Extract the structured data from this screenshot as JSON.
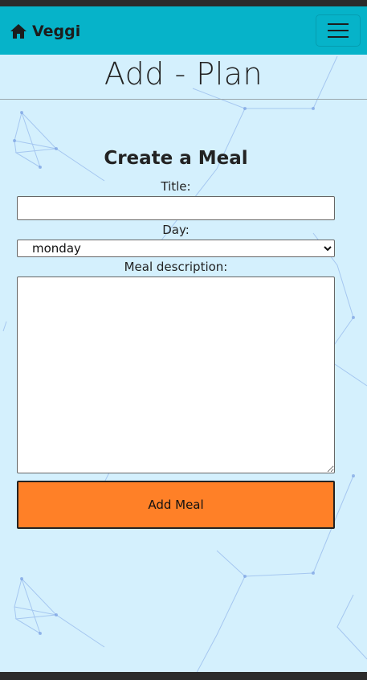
{
  "navbar": {
    "brand_label": "Veggi",
    "brand_icon": "home-icon",
    "toggle_icon": "hamburger-menu-icon"
  },
  "page": {
    "title": "Add - Plan"
  },
  "form": {
    "heading": "Create a Meal",
    "title_label": "Title:",
    "title_value": "",
    "day_label": "Day:",
    "day_selected": "monday",
    "description_label": "Meal description:",
    "description_value": "",
    "submit_label": "Add Meal"
  },
  "colors": {
    "navbar": "#06b3c9",
    "background": "#d4f0fd",
    "button": "#ff8027"
  }
}
